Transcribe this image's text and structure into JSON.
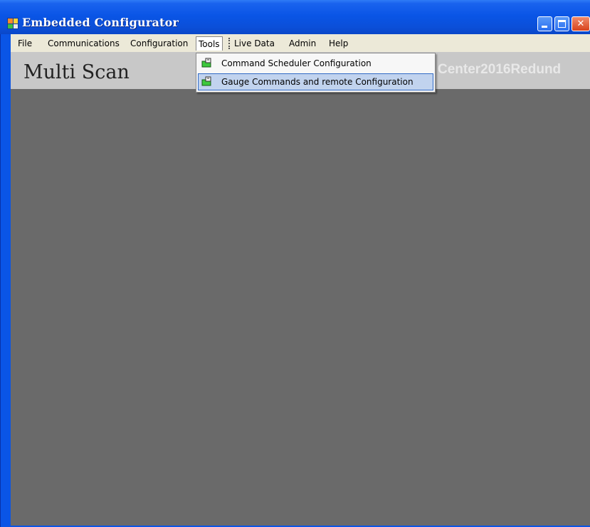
{
  "window": {
    "title": "Embedded Configurator"
  },
  "menubar": {
    "items": [
      "File",
      "Communications",
      "Configuration",
      "Tools",
      "Live Data",
      "Admin",
      "Help"
    ]
  },
  "banner": {
    "title": "Multi Scan",
    "right_text": "Center2016Redund"
  },
  "tools_menu": {
    "items": [
      {
        "label": "Command Scheduler Configuration",
        "icon": "scheduler-icon"
      },
      {
        "label": "Gauge Commands and remote Configuration",
        "icon": "gauge-icon",
        "highlighted": true
      }
    ]
  },
  "colors": {
    "titlebar": "#0a55e6",
    "client_background": "#6a6a6a",
    "menu_highlight": "#c1d3ee"
  }
}
